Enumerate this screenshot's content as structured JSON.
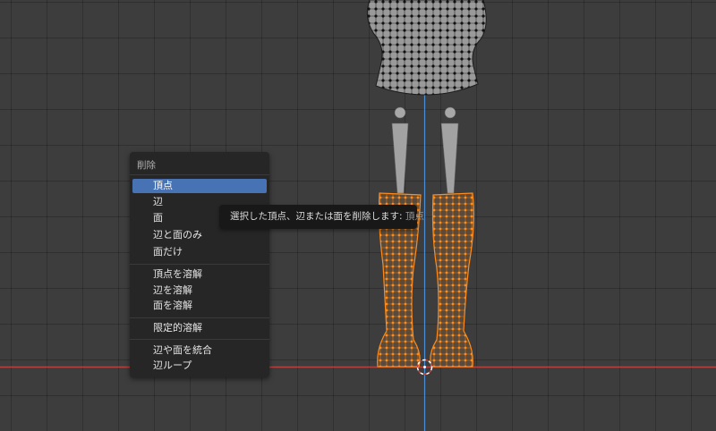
{
  "menu": {
    "title": "削除",
    "items": [
      {
        "label": "頂点",
        "active": true
      },
      {
        "label": "辺",
        "active": false
      },
      {
        "label": "面",
        "active": false
      },
      {
        "label": "辺と面のみ",
        "active": false
      },
      {
        "label": "面だけ",
        "active": false
      },
      {
        "label": "頂点を溶解",
        "active": false
      },
      {
        "label": "辺を溶解",
        "active": false
      },
      {
        "label": "面を溶解",
        "active": false
      },
      {
        "label": "限定的溶解",
        "active": false
      },
      {
        "label": "辺や面を統合",
        "active": false
      },
      {
        "label": "辺ループ",
        "active": false
      }
    ]
  },
  "tooltip": {
    "text": "選択した頂点、辺または面を削除します:",
    "value": "頂点"
  },
  "colors": {
    "viewport_bg": "#3d3d3d",
    "menu_bg": "#262626",
    "menu_highlight": "#4772b3",
    "tooltip_bg": "#181818",
    "selected_mesh": "#ff8c1a",
    "x_axis": "#c0443f",
    "z_axis": "#4a8fd6"
  }
}
